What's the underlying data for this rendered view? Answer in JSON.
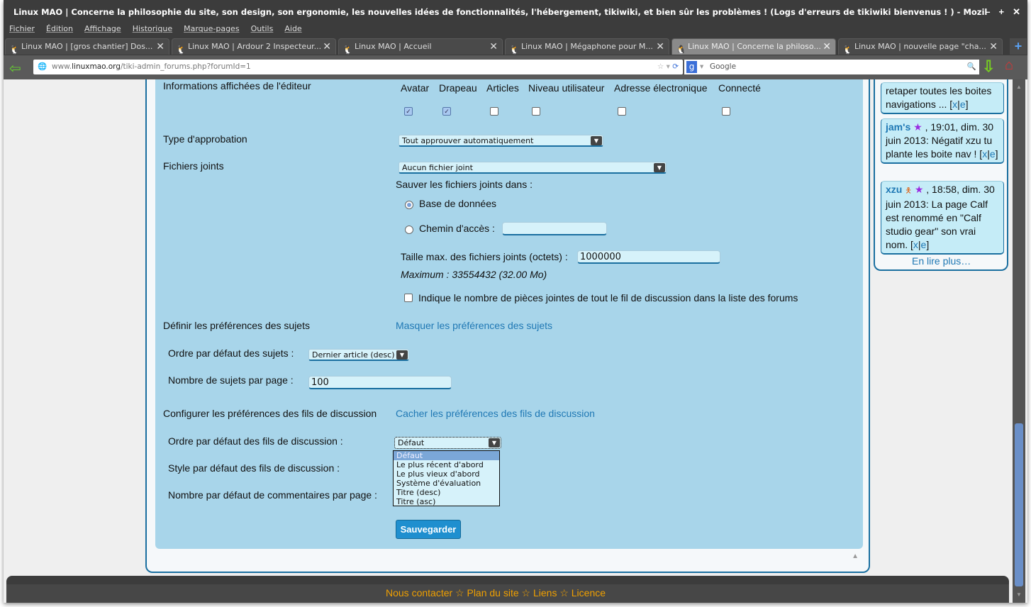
{
  "window": {
    "title": "Linux MAO | Concerne la philosophie du site, son design, son ergonomie, les nouvelles idées de fonctionnalités, l'hébergement, tikiwiki, et bien sûr les problèmes ! (Logs d'erreurs de tikiwiki bienvenus ! ) - Mozil",
    "min": "–",
    "max": "+",
    "close": "✕"
  },
  "menu": [
    "Fichier",
    "Édition",
    "Affichage",
    "Historique",
    "Marque-pages",
    "Outils",
    "Aide"
  ],
  "tabs": [
    {
      "label": "Linux MAO | [gros chantier] Dos..."
    },
    {
      "label": "Linux MAO | Ardour 2 Inspecteur..."
    },
    {
      "label": "Linux MAO | Accueil"
    },
    {
      "label": "Linux MAO | Mégaphone pour M..."
    },
    {
      "label": "Linux MAO | Concerne la philoso...",
      "active": true
    },
    {
      "label": "Linux MAO | nouvelle page \"cha..."
    }
  ],
  "nav": {
    "url_prefix": "www.",
    "url_domain": "linuxmao.org",
    "url_path": "/tiki-admin_forums.php?forumId=1",
    "search_placeholder": "Google"
  },
  "form": {
    "poster_info_label": "Informations affichées de l'éditeur",
    "poster_columns": [
      {
        "label": "Avatar",
        "checked": true
      },
      {
        "label": "Drapeau",
        "checked": true
      },
      {
        "label": "Articles",
        "checked": false
      },
      {
        "label": "Niveau utilisateur",
        "checked": false
      },
      {
        "label": "Adresse électronique",
        "checked": false
      },
      {
        "label": "Connecté",
        "checked": false
      }
    ],
    "approval_label": "Type d'approbation",
    "approval_value": "Tout approuver automatiquement",
    "attachments_label": "Fichiers joints",
    "attachments_value": "Aucun fichier joint",
    "store_in_label": "Sauver les fichiers joints dans :",
    "store_db": "Base de données",
    "store_path": "Chemin d'accès :",
    "store_path_value": "",
    "max_size_label": "Taille max. des fichiers joints (octets) :",
    "max_size_value": "1000000",
    "max_size_note": "Maximum : 33554432 (32.00 Mo)",
    "count_attachments_label": "Indique le nombre de pièces jointes de tout le fil de discussion dans la liste des forums",
    "topic_prefs_label": "Définir les préférences des sujets",
    "topic_prefs_link": "Masquer les préférences des sujets",
    "topic_order_label": "Ordre par défaut des sujets :",
    "topic_order_value": "Dernier article (desc)",
    "topics_per_page_label": "Nombre de sujets par page :",
    "topics_per_page_value": "100",
    "thread_prefs_label": "Configurer les préférences des fils de discussion",
    "thread_prefs_link": "Cacher les préférences des fils de discussion",
    "thread_order_label": "Ordre par défaut des fils de discussion :",
    "thread_order_value": "Défaut",
    "thread_order_options": [
      "Défaut",
      "Le plus récent d'abord",
      "Le plus vieux d'abord",
      "Système d'évaluation",
      "Titre (desc)",
      "Titre (asc)"
    ],
    "thread_style_label": "Style par défaut des fils de discussion :",
    "comments_per_page_label": "Nombre par défaut de commentaires par page :",
    "save_label": "Sauvegarder"
  },
  "shoutbox": {
    "items": [
      {
        "text": "retaper toutes les boites navigations ...",
        "x": "x",
        "e": "e"
      },
      {
        "user": "jam's",
        "text": ", 19:01, dim. 30 juin 2013: Négatif xzu tu plante les boite nav !",
        "x": "x",
        "e": "e"
      },
      {
        "user": "xzu",
        "text": ", 18:58, dim. 30 juin 2013: La page Calf est renommé en \"Calf studio gear\" son vrai nom.",
        "x": "x",
        "e": "e"
      }
    ],
    "more": "En lire plus…"
  },
  "footer": {
    "links": "Nous contacter ☆ Plan du site ☆ Liens ☆ Licence"
  }
}
